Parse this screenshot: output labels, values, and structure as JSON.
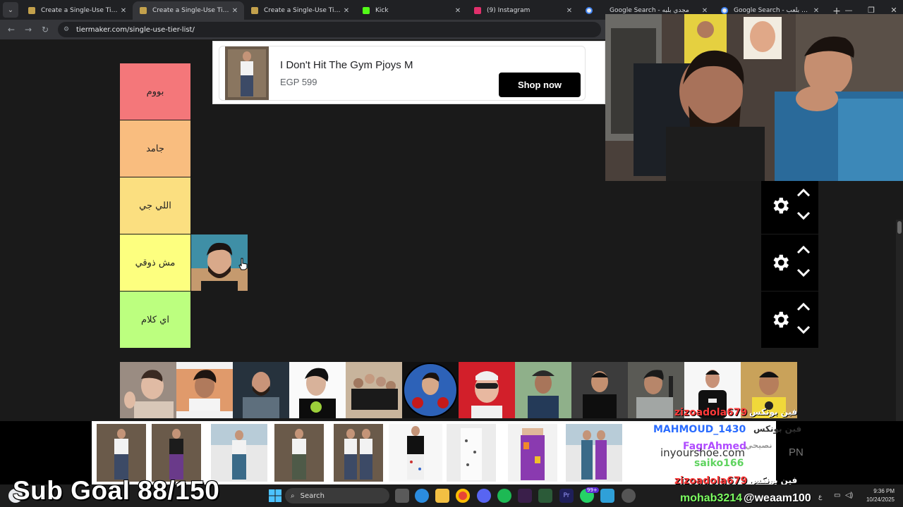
{
  "browser": {
    "tabs": [
      {
        "title": "Create a Single-Use Tier List (P",
        "favicon_color": "#c3a14c",
        "active": false
      },
      {
        "title": "Create a Single-Use Tier List (P",
        "favicon_color": "#c3a14c",
        "active": true
      },
      {
        "title": "Create a Single-Use Tier List (P",
        "favicon_color": "#c3a14c",
        "active": false
      },
      {
        "title": "Kick",
        "favicon_color": "#53fc18",
        "active": false
      },
      {
        "title": "(9) Instagram",
        "favicon_color": "#e1306c",
        "active": false
      },
      {
        "title": "",
        "favicon_color": "#4285f4",
        "active": false
      },
      {
        "title": "Google Search - مجدي بلبه",
        "favicon_color": "#4285f4",
        "active": false
      },
      {
        "title": "Google Search - كريم بلعب",
        "favicon_color": "#4285f4",
        "active": false
      }
    ],
    "url": "tiermaker.com/single-use-tier-list/"
  },
  "ad": {
    "title": "I Don't Hit The Gym Pjoys M",
    "price": "EGP 599",
    "cta": "Shop now"
  },
  "tiers": [
    {
      "label": "بووم",
      "color": "#f4777a"
    },
    {
      "label": "جامد",
      "color": "#f9bd7f"
    },
    {
      "label": "اللي جي",
      "color": "#fbdf80"
    },
    {
      "label": "مش ذوقي",
      "color": "#fdff7f"
    },
    {
      "label": "اي كلام",
      "color": "#bcff7f"
    }
  ],
  "stream": {
    "chat": [
      {
        "user": "zizoadola679",
        "color": "#ff3a3a"
      },
      {
        "user": "MAHMOUD_1430",
        "color": "#2a6cff"
      },
      {
        "user": "FagrAhmed",
        "color": "#b04bff"
      },
      {
        "user": "inyourshoe.com",
        "color": "#333333"
      },
      {
        "user": "saiko166",
        "color": "#5fd35f"
      },
      {
        "user": "zizoadola679",
        "color": "#ff3a3a"
      }
    ],
    "chat_arabic": [
      "فين بونكس",
      "فين بونكس",
      "نصيحي",
      "فين بونكس"
    ],
    "pn_label": "PN",
    "sub_goal": "Sub Goal 88/150",
    "latest_sub": "mohab3214",
    "latest_follow": "@weaam100"
  },
  "taskbar": {
    "search_label": "Search",
    "time": "9:36 PM",
    "date": "10/24/2025",
    "lang": "ع",
    "weather_label": "",
    "badge": "99+"
  }
}
